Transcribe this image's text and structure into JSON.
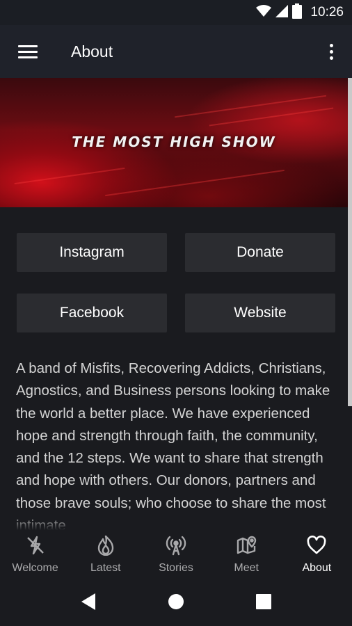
{
  "status_bar": {
    "time": "10:26",
    "icons": [
      "wifi-icon",
      "signal-icon",
      "battery-icon"
    ]
  },
  "app_bar": {
    "title": "About",
    "icons": [
      "menu-icon",
      "more-vert-icon"
    ]
  },
  "banner": {
    "title": "THE MOST HIGH SHOW"
  },
  "links": [
    {
      "label": "Instagram"
    },
    {
      "label": "Donate"
    },
    {
      "label": "Facebook"
    },
    {
      "label": "Website"
    }
  ],
  "description": "A band of Misfits, Recovering Addicts, Christians, Agnostics, and Business persons looking to make the world a better place. We have experienced hope and strength through faith, the community, and the 12 steps. We want to share that strength and hope with others. Our donors, partners and those brave souls; who choose to share the most intimate",
  "bottom_nav": {
    "items": [
      {
        "label": "Welcome",
        "icon": "flash-icon",
        "active": false
      },
      {
        "label": "Latest",
        "icon": "flame-icon",
        "active": false
      },
      {
        "label": "Stories",
        "icon": "broadcast-icon",
        "active": false
      },
      {
        "label": "Meet",
        "icon": "map-pin-icon",
        "active": false
      },
      {
        "label": "About",
        "icon": "heart-icon",
        "active": true
      }
    ]
  },
  "system_nav": {
    "icons": [
      "back-icon",
      "home-icon",
      "recents-icon"
    ]
  },
  "colors": {
    "status_bar": "#1b1e24",
    "app_bar": "#1f222a",
    "background": "#1a1b1f",
    "button": "#2b2c30",
    "text": "#d4d4d4",
    "inactive_nav": "#a9a9ab",
    "accent_red": "#d1101a"
  }
}
